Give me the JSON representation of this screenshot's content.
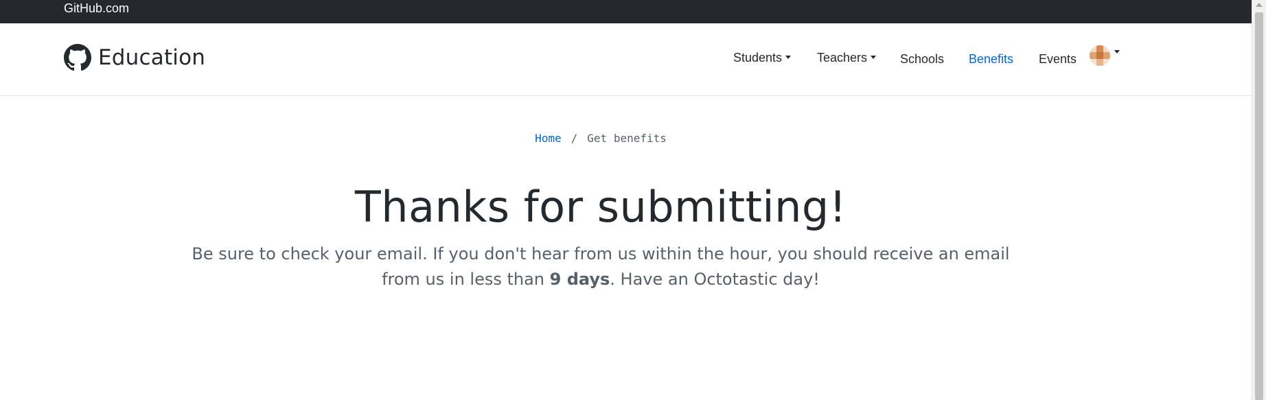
{
  "topbar": {
    "link_label": "GitHub.com"
  },
  "header": {
    "brand_title": "Education",
    "nav": {
      "students": "Students",
      "teachers": "Teachers",
      "schools": "Schools",
      "benefits": "Benefits",
      "events": "Events"
    },
    "active_nav": "Benefits",
    "accent_color": "#0366d6"
  },
  "breadcrumb": {
    "home": "Home",
    "separator": "/",
    "current": "Get benefits"
  },
  "main": {
    "headline": "Thanks for submitting!",
    "lead_part1": "Be sure to check your email. If you don't hear from us within the hour, you should receive an email from us in less than ",
    "lead_bold": "9 days",
    "lead_part2": ". Have an Octotastic day!"
  },
  "icons": {
    "brand": "github-octocat-icon",
    "dropdown": "caret-down-icon",
    "avatar": "user-avatar"
  },
  "colors": {
    "topbar_bg": "#24292e",
    "text": "#24292e",
    "muted": "#586069",
    "link": "#0366d6"
  }
}
